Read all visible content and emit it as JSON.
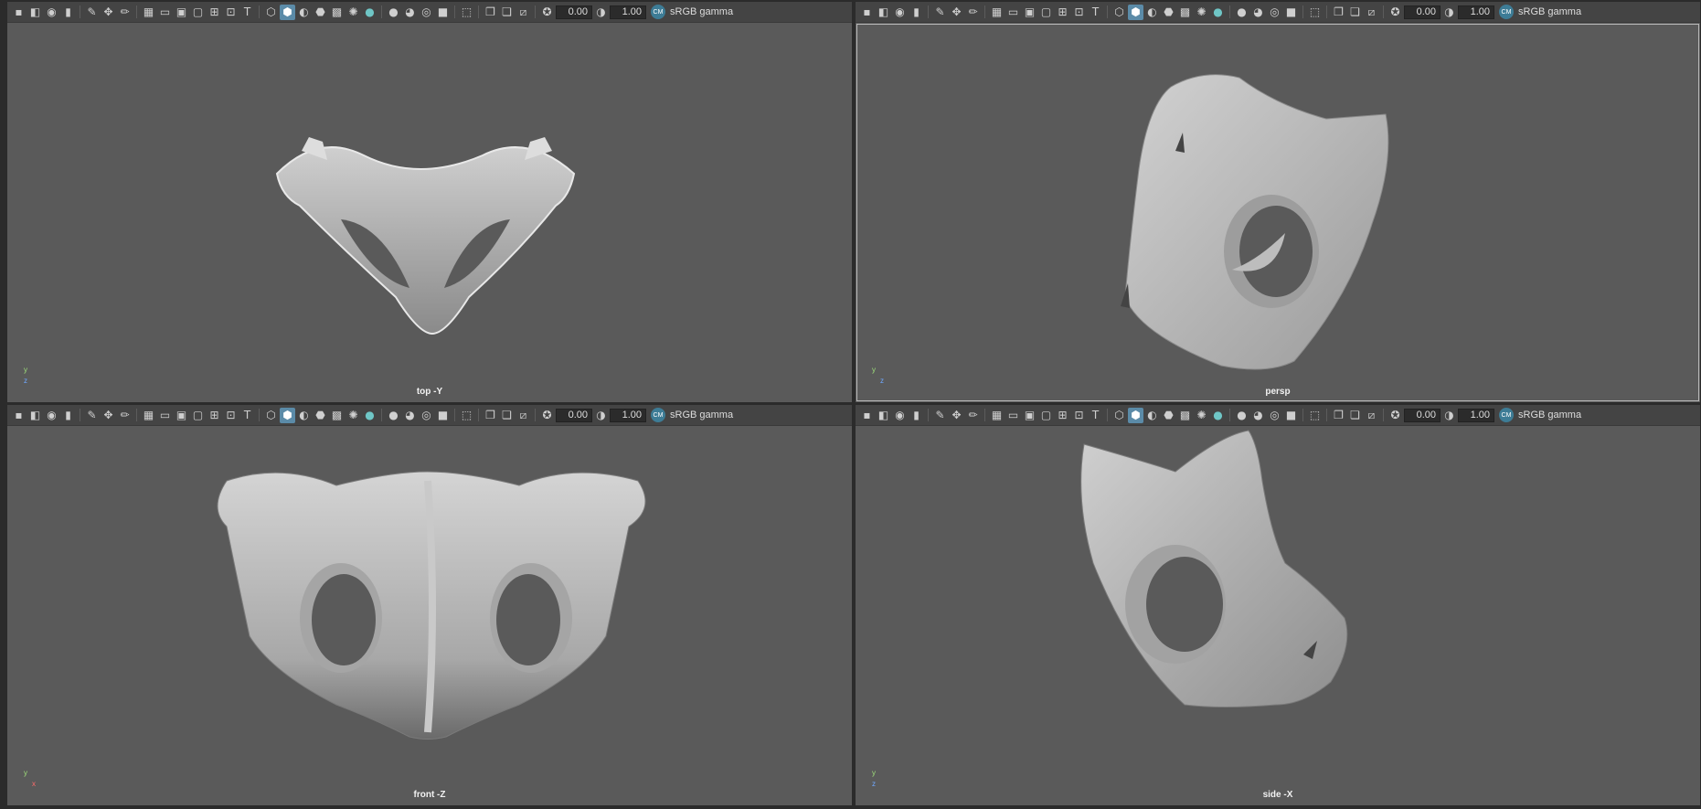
{
  "toolbar": {
    "exposure_value": "0.00",
    "gamma_value": "1.00",
    "color_space": "sRGB gamma",
    "colorspace_badge": "CM"
  },
  "panels": [
    {
      "camera_label": "top -Y",
      "axis_a": "y",
      "axis_b": "z",
      "axis_b_color": "#6fa8ff"
    },
    {
      "camera_label": "persp",
      "axis_a": "y",
      "axis_b": "z",
      "axis_b_color": "#6fa8ff"
    },
    {
      "camera_label": "front -Z",
      "axis_a": "y",
      "axis_b": "x",
      "axis_b_color": "#ff6b6b"
    },
    {
      "camera_label": "side -X",
      "axis_a": "y",
      "axis_b": "z",
      "axis_b_color": "#6fa8ff"
    }
  ],
  "icons": {
    "camera": "camera-icon",
    "select_camera": "select-camera-icon",
    "bookmark": "bookmark-icon",
    "grid": "grid-icon",
    "wireframe": "wireframe-icon",
    "smooth_shade": "smooth-shade-icon",
    "light": "light-icon",
    "isolate": "isolate-icon",
    "xray": "xray-icon",
    "exposure": "exposure-icon",
    "gamma": "gamma-icon"
  },
  "colors": {
    "viewport_bg": "#5a5a5a",
    "toolbar_bg": "#444444",
    "active_button": "#5b8ba8",
    "mesh": "#b9b9b9"
  }
}
